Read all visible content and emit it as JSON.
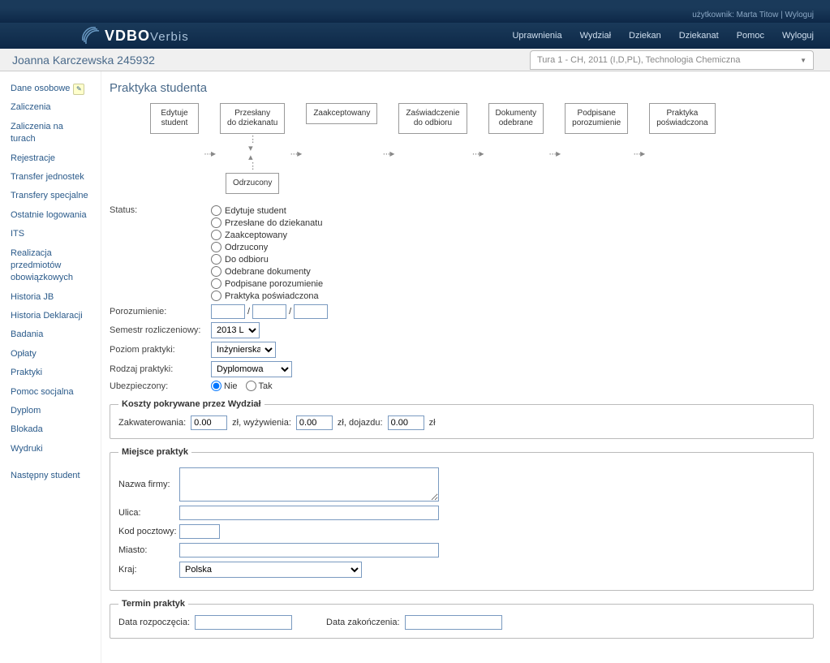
{
  "user": {
    "label": "użytkownik:",
    "name": "Marta Titow",
    "logout": "Wyloguj"
  },
  "logo": {
    "main": "VDBO",
    "sub": "Verbis"
  },
  "nav": [
    "Uprawnienia",
    "Wydział",
    "Dziekan",
    "Dziekanat",
    "Pomoc",
    "Wyloguj"
  ],
  "student_name": "Joanna Karczewska 245932",
  "tour_selected": "Tura 1 - CH, 2011 (I,D,PL), Technologia Chemiczna",
  "sidebar": {
    "items": [
      "Dane osobowe",
      "Zaliczenia",
      "Zaliczenia na turach",
      "Rejestracje",
      "Transfer jednostek",
      "Transfery specjalne",
      "Ostatnie logowania",
      "ITS",
      "Realizacja przedmiotów obowiązkowych",
      "Historia JB",
      "Historia Deklaracji",
      "Badania",
      "Opłaty",
      "Praktyki",
      "Pomoc socjalna",
      "Dyplom",
      "Blokada",
      "Wydruki"
    ],
    "next": "Następny student"
  },
  "page_title": "Praktyka studenta",
  "flow": {
    "b0": "Edytuje\nstudent",
    "b1": "Przesłany\ndo dziekanatu",
    "b2": "Zaakceptowany",
    "b3": "Zaświadczenie\ndo odbioru",
    "b4": "Dokumenty\nodebrane",
    "b5": "Podpisane\nporozumienie",
    "b6": "Praktyka\npoświadczona",
    "rej": "Odrzucony"
  },
  "status": {
    "label": "Status:",
    "opts": [
      "Edytuje student",
      "Przesłane do dziekanatu",
      "Zaakceptowany",
      "Odrzucony",
      "Do odbioru",
      "Odebrane dokumenty",
      "Podpisane porozumienie",
      "Praktyka poświadczona"
    ]
  },
  "labels": {
    "porozumienie": "Porozumienie:",
    "semestr": "Semestr rozliczeniowy:",
    "poziom": "Poziom praktyki:",
    "rodzaj": "Rodzaj praktyki:",
    "ubezp": "Ubezpieczony:"
  },
  "fields": {
    "semestr_selected": "2013 L",
    "poziom_selected": "Inżynierska",
    "rodzaj_selected": "Dyplomowa",
    "ubezp_nie": "Nie",
    "ubezp_tak": "Tak"
  },
  "koszty": {
    "legend": "Koszty pokrywane przez Wydział",
    "zakw_label": "Zakwaterowania:",
    "zakw_val": "0.00",
    "wyz_label": "zł, wyżywienia:",
    "wyz_val": "0.00",
    "doj_label": "zł, dojazdu:",
    "doj_val": "0.00",
    "suffix": "zł"
  },
  "miejsce": {
    "legend": "Miejsce praktyk",
    "firma": "Nazwa firmy:",
    "ulica": "Ulica:",
    "kod": "Kod pocztowy:",
    "miasto": "Miasto:",
    "kraj": "Kraj:",
    "kraj_val": "Polska"
  },
  "termin": {
    "legend": "Termin praktyk",
    "start": "Data rozpoczęcia:",
    "end": "Data zakończenia:"
  }
}
